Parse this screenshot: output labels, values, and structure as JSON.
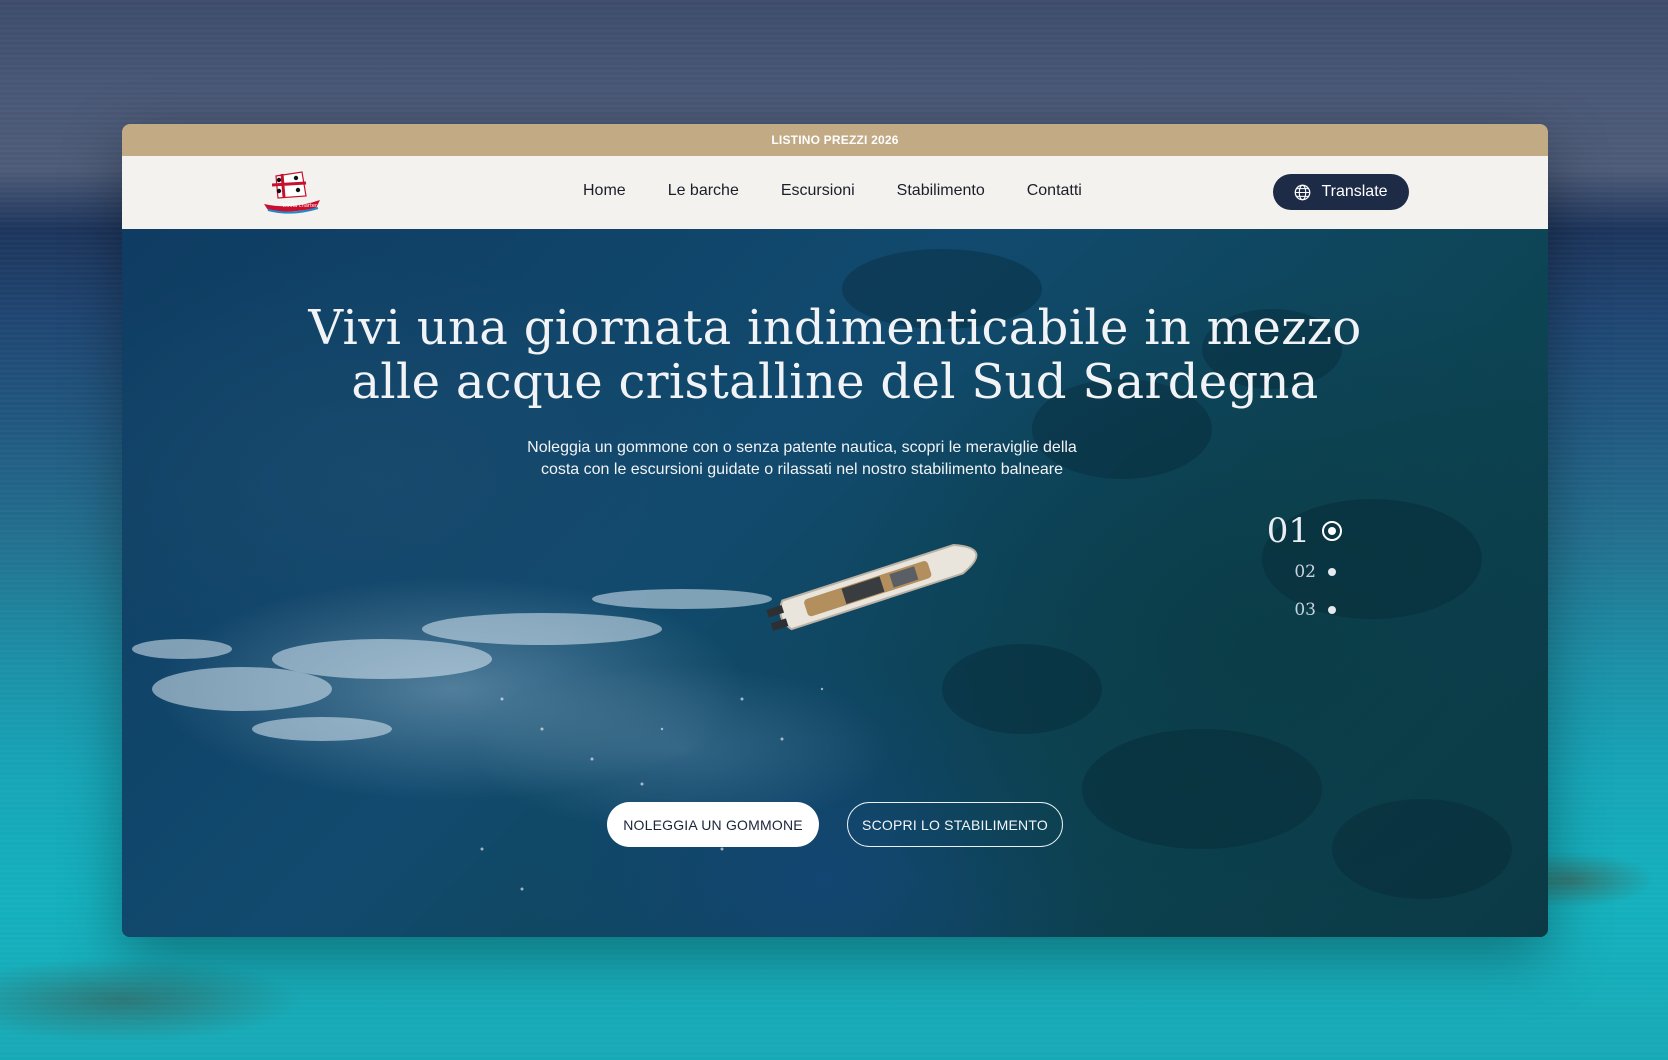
{
  "announcement": {
    "text": "LISTINO PREZZI 2026"
  },
  "nav": {
    "logo_text": "Trinità charter",
    "items": [
      "Home",
      "Le barche",
      "Escursioni",
      "Stabilimento",
      "Contatti"
    ],
    "translate_label": "Translate"
  },
  "hero": {
    "title_line1": "Vivi una giornata indimenticabile in mezzo",
    "title_line2": "alle acque cristalline del Sud Sardegna",
    "subtitle_line1": "Noleggia un gommone con o senza patente nautica, scopri le meraviglie della",
    "subtitle_line2": "costa con le escursioni guidate o rilassati nel nostro stabilimento balneare",
    "slides": [
      "01",
      "02",
      "03"
    ],
    "active_slide": "01",
    "primary_button": "NOLEGGIA UN GOMMONE",
    "secondary_button": "SCOPRI LO STABILIMENTO"
  },
  "colors": {
    "announcement_bg": "#c2aa85",
    "nav_bg": "#f4f2ee",
    "translate_bg": "#1d2b46"
  }
}
